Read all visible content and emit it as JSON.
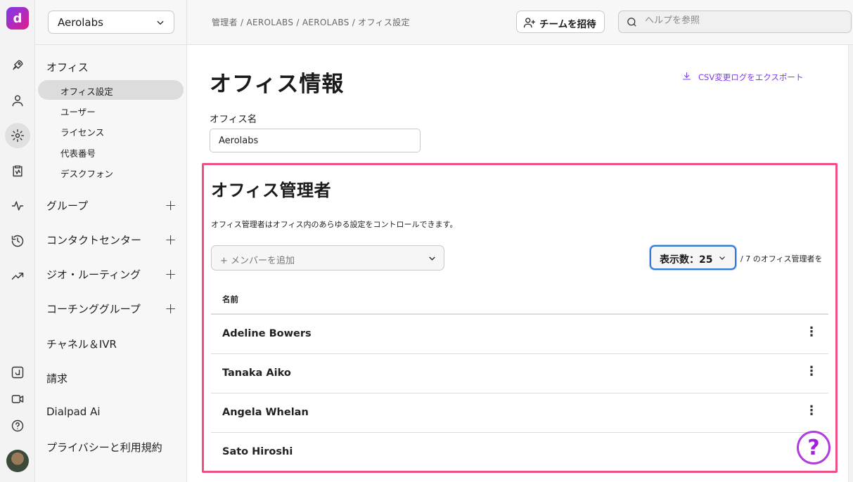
{
  "rail": {
    "logo": "d",
    "icons": [
      "rocket-icon",
      "person-icon",
      "gear-icon",
      "clipboard-icon",
      "activity-icon",
      "history-icon",
      "trending-icon",
      "dialpad-app-icon",
      "video-icon",
      "help-circle-icon"
    ]
  },
  "sidebar": {
    "workspace": "Aerolabs",
    "office_section": "オフィス",
    "office_items": [
      "オフィス設定",
      "ユーザー",
      "ライセンス",
      "代表番号",
      "デスクフォン"
    ],
    "sections": [
      "グループ",
      "コンタクトセンター",
      "ジオ・ルーティング",
      "コーチンググループ",
      "チャネル＆IVR",
      "請求",
      "Dialpad Ai",
      "プライバシーと利用規約"
    ]
  },
  "topbar": {
    "breadcrumb": "管理者 / AEROLABS / AEROLABS / オフィス設定",
    "invite_label": "チームを招待",
    "search_placeholder": "ヘルプを参照"
  },
  "main": {
    "title": "オフィス情報",
    "csv_export": "CSV変更ログをエクスポート",
    "office_name_label": "オフィス名",
    "office_name_value": "Aerolabs"
  },
  "admins": {
    "title": "オフィス管理者",
    "description": "オフィス管理者はオフィス内のあらゆる設定をコントロールできます。",
    "add_member_placeholder": "+ メンバーを追加",
    "per_page": "表示数：25",
    "count_text": "/ 7 のオフィス管理者を",
    "column_name": "名前",
    "rows": [
      "Adeline Bowers",
      "Tanaka Aiko",
      "Angela Whelan",
      "Sato Hiroshi"
    ]
  },
  "colors": {
    "accent": "#7c3aed",
    "highlight_border": "#ee4f86",
    "focus": "#2f7bd6"
  }
}
